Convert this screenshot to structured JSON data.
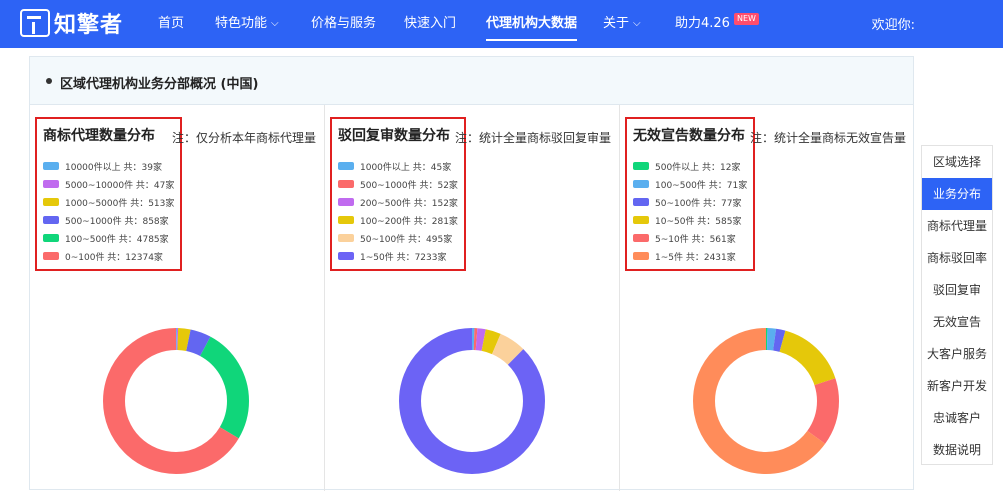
{
  "brand": {
    "name": "知擎者"
  },
  "nav": [
    {
      "label": "首页",
      "caret": false,
      "active": false
    },
    {
      "label": "特色功能",
      "caret": true,
      "active": false
    },
    {
      "label": "价格与服务",
      "caret": false,
      "active": false
    },
    {
      "label": "快速入门",
      "caret": false,
      "active": false
    },
    {
      "label": "代理机构大数据",
      "caret": false,
      "active": true
    },
    {
      "label": "关于",
      "caret": true,
      "active": false
    },
    {
      "label": "助力4.26",
      "caret": false,
      "active": false,
      "badge": "NEW"
    }
  ],
  "welcome": "欢迎你:",
  "panel": {
    "title": "区域代理机构业务分部概况 (中国)"
  },
  "columns": [
    {
      "title": "商标代理数量分布",
      "note": "注：仅分析本年商标代理量",
      "legend": [
        {
          "label": "10000件以上 共：39家",
          "color": "#5aafef"
        },
        {
          "label": "5000~10000件 共：47家",
          "color": "#c06bef"
        },
        {
          "label": "1000~5000件 共：513家",
          "color": "#e5c80a"
        },
        {
          "label": "500~1000件 共：858家",
          "color": "#6366f1"
        },
        {
          "label": "100~500件 共：4785家",
          "color": "#10d67a"
        },
        {
          "label": "0~100件 共：12374家",
          "color": "#fb6a6a"
        }
      ],
      "values": [
        39,
        47,
        513,
        858,
        4785,
        12374
      ]
    },
    {
      "title": "驳回复审数量分布",
      "note": "注：统计全量商标驳回复审量",
      "legend": [
        {
          "label": "1000件以上 共：45家",
          "color": "#5aafef"
        },
        {
          "label": "500~1000件 共：52家",
          "color": "#fb6a6a"
        },
        {
          "label": "200~500件 共：152家",
          "color": "#c06bef"
        },
        {
          "label": "100~200件 共：281家",
          "color": "#e5c80a"
        },
        {
          "label": "50~100件 共：495家",
          "color": "#fbd19b"
        },
        {
          "label": "1~50件 共：7233家",
          "color": "#6c63f5"
        }
      ],
      "values": [
        45,
        52,
        152,
        281,
        495,
        7233
      ]
    },
    {
      "title": "无效宣告数量分布",
      "note": "注：统计全量商标无效宣告量",
      "legend": [
        {
          "label": "500件以上 共：12家",
          "color": "#10d67a"
        },
        {
          "label": "100~500件 共：71家",
          "color": "#5aafef"
        },
        {
          "label": "50~100件 共：77家",
          "color": "#6366f1"
        },
        {
          "label": "10~50件 共：585家",
          "color": "#e5c80a"
        },
        {
          "label": "5~10件 共：561家",
          "color": "#fb6a6a"
        },
        {
          "label": "1~5件 共：2431家",
          "color": "#ff8c5a"
        }
      ],
      "values": [
        12,
        71,
        77,
        585,
        561,
        2431
      ]
    }
  ],
  "sidebar": [
    {
      "label": "区域选择",
      "active": false
    },
    {
      "label": "业务分布",
      "active": true
    },
    {
      "label": "商标代理量",
      "active": false
    },
    {
      "label": "商标驳回率",
      "active": false
    },
    {
      "label": "驳回复审",
      "active": false
    },
    {
      "label": "无效宣告",
      "active": false
    },
    {
      "label": "大客户服务",
      "active": false
    },
    {
      "label": "新客户开发",
      "active": false
    },
    {
      "label": "忠诚客户",
      "active": false
    },
    {
      "label": "数据说明",
      "active": false
    }
  ]
}
